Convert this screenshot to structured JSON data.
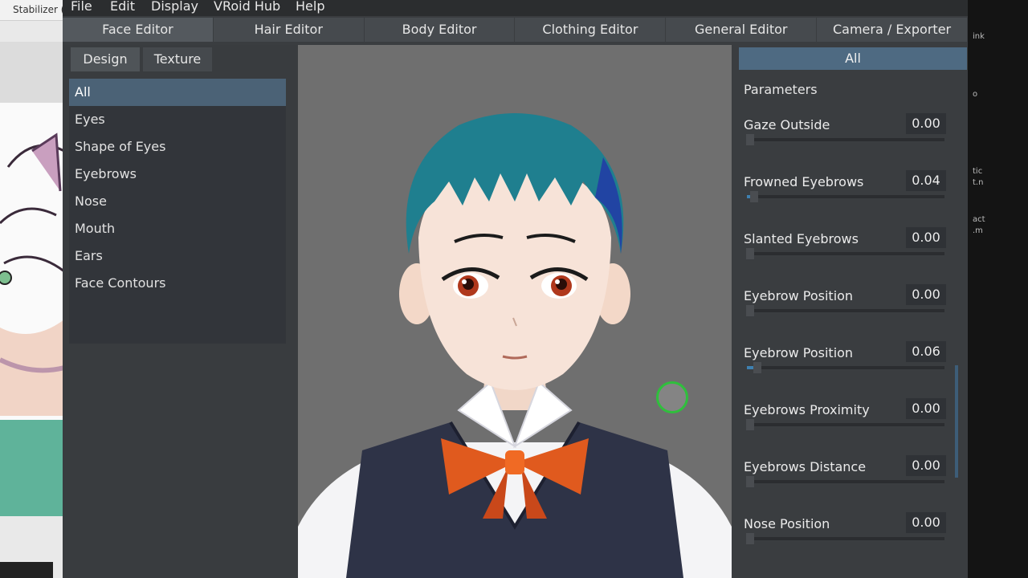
{
  "background_app": {
    "title": "Stabilizer (",
    "right_fragments": [
      "ink",
      "o",
      "tic",
      "t.n",
      "act",
      ".m"
    ]
  },
  "menubar": {
    "items": [
      "File",
      "Edit",
      "Display",
      "VRoid Hub",
      "Help"
    ]
  },
  "editor_tabs": [
    "Face Editor",
    "Hair Editor",
    "Body Editor",
    "Clothing Editor",
    "General Editor",
    "Camera / Exporter"
  ],
  "active_editor_tab": "Face Editor",
  "left_panel": {
    "sub_tabs": [
      "Design",
      "Texture"
    ],
    "active_sub_tab": "Design",
    "categories": [
      "All",
      "Eyes",
      "Shape of Eyes",
      "Eyebrows",
      "Nose",
      "Mouth",
      "Ears",
      "Face Contours"
    ],
    "selected_category": "All"
  },
  "right_panel": {
    "header": "All",
    "title": "Parameters",
    "params": [
      {
        "label": "Gaze Outside",
        "value": "0.00",
        "level": 0.0
      },
      {
        "label": "Frowned Eyebrows",
        "value": "0.04",
        "level": 0.04
      },
      {
        "label": "Slanted Eyebrows",
        "value": "0.00",
        "level": 0.0
      },
      {
        "label": "Eyebrow Position",
        "value": "0.00",
        "level": 0.0
      },
      {
        "label": "Eyebrow Position",
        "value": "0.06",
        "level": 0.06
      },
      {
        "label": "Eyebrows Proximity",
        "value": "0.00",
        "level": 0.0
      },
      {
        "label": "Eyebrows Distance",
        "value": "0.00",
        "level": 0.0
      },
      {
        "label": "Nose Position",
        "value": "0.00",
        "level": 0.0
      }
    ]
  },
  "colors": {
    "accent": "#4e6a82",
    "selected": "#4b6276",
    "slider_fill": "#3e80b0",
    "hair": "#1f7f8f",
    "cursor_ring": "#2fbf3c"
  }
}
